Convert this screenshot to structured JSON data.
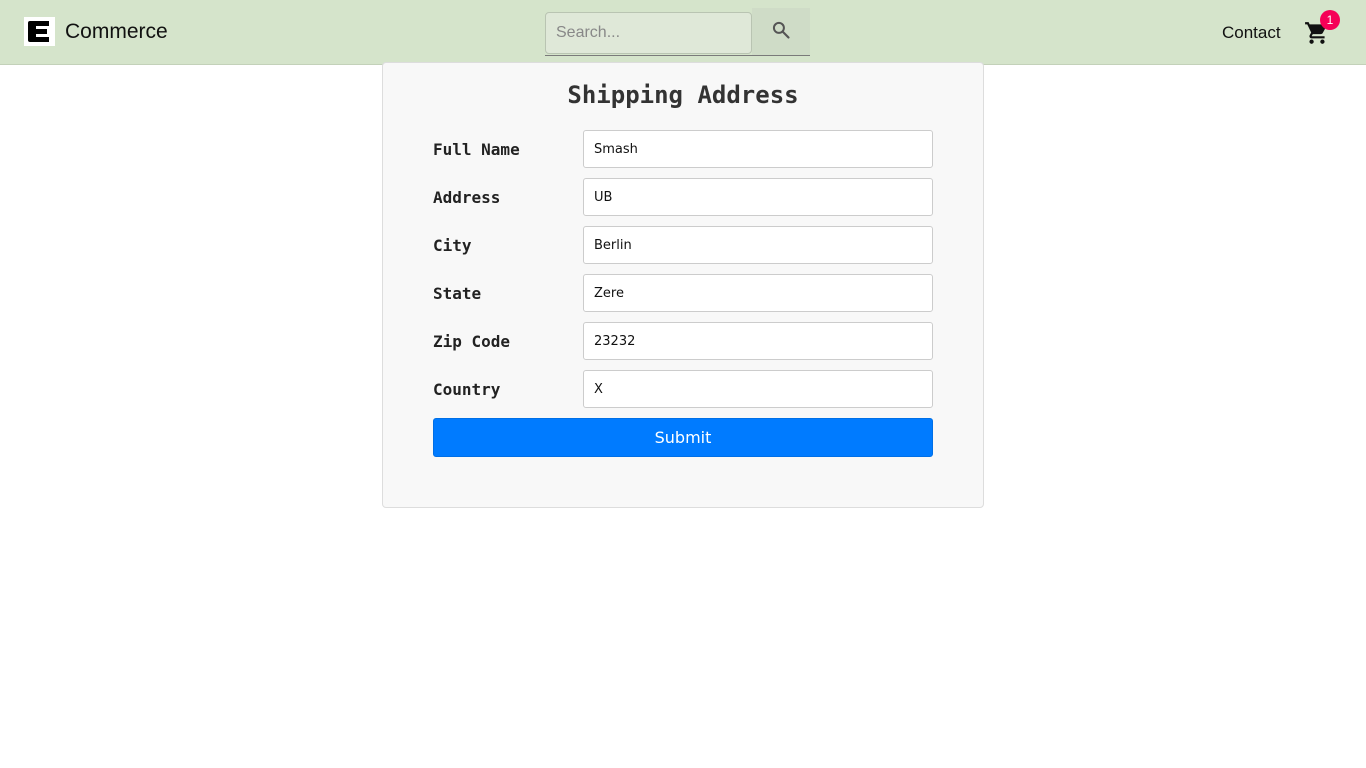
{
  "header": {
    "brand": "Commerce",
    "search_placeholder": "Search...",
    "contact_label": "Contact",
    "cart_count": "1"
  },
  "form": {
    "title": "Shipping Address",
    "fields": [
      {
        "label": "Full Name",
        "value": "Smash"
      },
      {
        "label": "Address",
        "value": "UB"
      },
      {
        "label": "City",
        "value": "Berlin"
      },
      {
        "label": "State",
        "value": "Zere"
      },
      {
        "label": "Zip Code",
        "value": "23232"
      },
      {
        "label": "Country",
        "value": "X"
      }
    ],
    "submit_label": "Submit"
  },
  "icons": {
    "logo": "logo-e-icon",
    "search": "search-icon",
    "cart": "cart-icon"
  },
  "colors": {
    "header_bg": "#d5e4cb",
    "primary": "#007bff",
    "badge": "#f50057"
  }
}
